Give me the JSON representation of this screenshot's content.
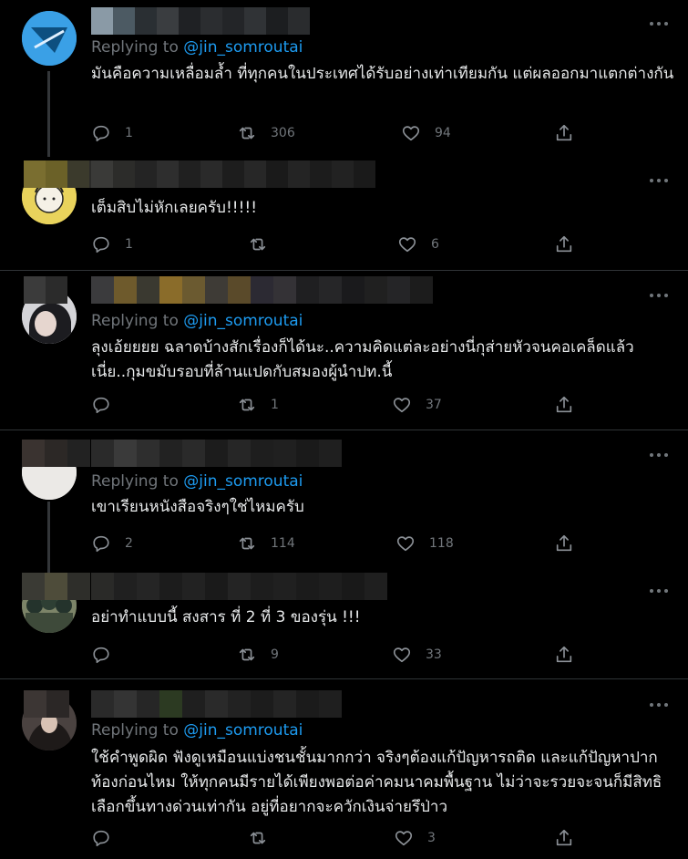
{
  "reply_prefix": "Replying to",
  "reply_handle": "@jin_somroutai",
  "colors": {
    "background": "#000000",
    "text": "#e7e9ea",
    "muted": "#71767b",
    "link": "#1d9bf0",
    "divider": "#2f3336"
  },
  "icons": {
    "reply": "reply-icon",
    "retweet": "retweet-icon",
    "like": "heart-icon",
    "share": "share-icon",
    "more": "more-icon"
  },
  "tweets": [
    {
      "text": "มันคือความเหลื่อมล้ำ ที่ทุกคนในประเทศได้รับอย่างเท่าเทียมกัน แต่ผลออกมาแตกต่างกัน",
      "replies": "1",
      "retweets": "306",
      "likes": "94"
    },
    {
      "text": "เต็มสิบไม่หักเลยครับ!!!!!",
      "replies": "1",
      "retweets": "",
      "likes": "6"
    },
    {
      "text": "ลุงเอ้ยยยย ฉลาดบ้างสักเรื่องก็ได้นะ..ความคิดแต่ละอย่างนี่กุส่ายหัวจนคอเคล็ดแล้ว เนี่ย..กุมขมับรอบที่ล้านแปดกับสมองผู้นำปท.นี้",
      "replies": "",
      "retweets": "1",
      "likes": "37"
    },
    {
      "text": "เขาเรียนหนังสือจริงๆใช่ไหมครับ",
      "replies": "2",
      "retweets": "114",
      "likes": "118"
    },
    {
      "text": "อย่าทำแบบนี้ สงสาร ที่ 2 ที่ 3 ของรุ่น !!!",
      "replies": "",
      "retweets": "9",
      "likes": "33"
    },
    {
      "text": "ใช้คำพูดผิด ฟังดูเหมือนแบ่งชนชั้นมากกว่า จริงๆต้องแก้ปัญหารถติด และแก้ปัญหาปากท้องก่อนไหม ให้ทุกคนมีรายได้เพียงพอต่อค่าคมนาคมพื้นฐาน ไม่ว่าจะรวยจะจนก็มีสิทธิเลือกขึ้นทางด่วนเท่ากัน อยู่ที่อยากจะควักเงินจ่ายรึป่าว",
      "replies": "",
      "retweets": "",
      "likes": "3"
    }
  ]
}
